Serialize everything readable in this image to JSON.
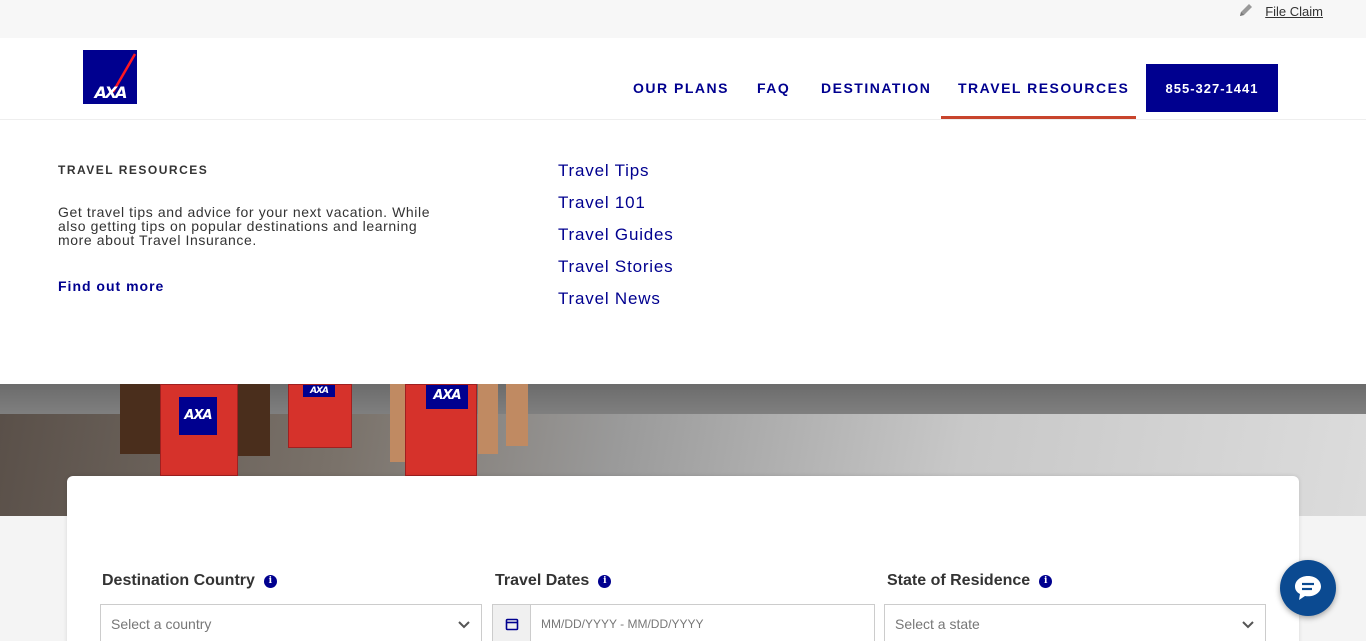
{
  "utility": {
    "file_claim": "File Claim"
  },
  "header": {
    "logo_text": "AXA",
    "nav": [
      {
        "label": "OUR PLANS"
      },
      {
        "label": "FAQ"
      },
      {
        "label": "DESTINATION"
      },
      {
        "label": "TRAVEL RESOURCES",
        "active": true
      }
    ],
    "phone": "855-327-1441"
  },
  "mega_menu": {
    "title": "TRAVEL RESOURCES",
    "description": "Get travel tips and advice for your next vacation. While also getting tips on popular destinations and learning more about Travel Insurance.",
    "cta": "Find out more",
    "links": [
      "Travel Tips",
      "Travel 101",
      "Travel Guides",
      "Travel Stories",
      "Travel News"
    ]
  },
  "quote_form": {
    "destination": {
      "label": "Destination Country",
      "placeholder": "Select a country"
    },
    "dates": {
      "label": "Travel Dates",
      "placeholder": "MM/DD/YYYY - MM/DD/YYYY"
    },
    "state": {
      "label": "State of Residence",
      "placeholder": "Select a state"
    }
  },
  "colors": {
    "brand_blue": "#00008f",
    "active_underline": "#c8442c",
    "chat_blue": "#0b4a91"
  },
  "icons": {
    "file_claim": "pencil-icon",
    "info": "info-icon",
    "calendar": "calendar-icon",
    "dropdown": "chevron-down-icon",
    "chat": "chat-bubble-icon"
  }
}
